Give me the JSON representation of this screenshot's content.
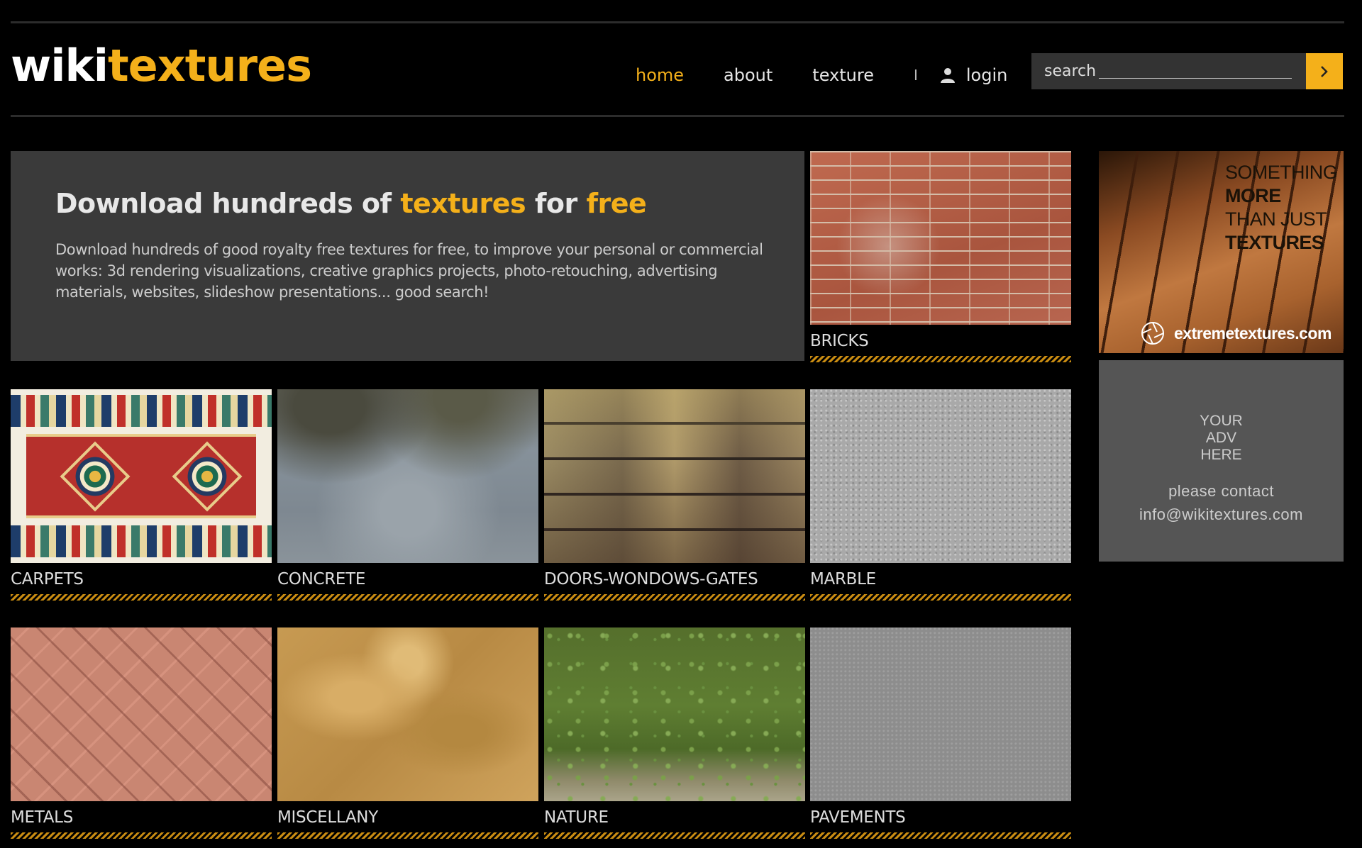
{
  "header": {
    "logo": {
      "part1": "wiki",
      "part2": "textures"
    },
    "nav": {
      "home": "home",
      "about": "about",
      "texture": "texture",
      "separator": "I",
      "login": "login"
    },
    "search": {
      "placeholder": "search"
    },
    "accent_color": "#f4b01a"
  },
  "hero": {
    "title_part1": "Download hundreds of ",
    "title_highlight1": "textures",
    "title_part2": " for ",
    "title_highlight2": "free",
    "description": "Download hundreds of good royalty free textures for free, to improve your personal or commercial works: 3d rendering visualizations, creative graphics projects, photo-retouching, advertising materials, websites, slideshow presentations... good search!"
  },
  "categories": [
    {
      "label": "BRICKS"
    },
    {
      "label": "CARPETS"
    },
    {
      "label": "CONCRETE"
    },
    {
      "label": "DOORS-WONDOWS-GATES"
    },
    {
      "label": "MARBLE"
    },
    {
      "label": "METALS"
    },
    {
      "label": "MISCELLANY"
    },
    {
      "label": "NATURE"
    },
    {
      "label": "PAVEMENTS"
    }
  ],
  "sidebar": {
    "promo": {
      "line1": "SOMETHING",
      "line2": "MORE",
      "line3": "THAN JUST",
      "line4": "TEXTURES",
      "brand": "extremetextures.com"
    },
    "ad": {
      "line1": "YOUR",
      "line2": "ADV",
      "line3": "HERE",
      "contact1": "please contact",
      "contact2": "info@wikitextures.com"
    }
  }
}
